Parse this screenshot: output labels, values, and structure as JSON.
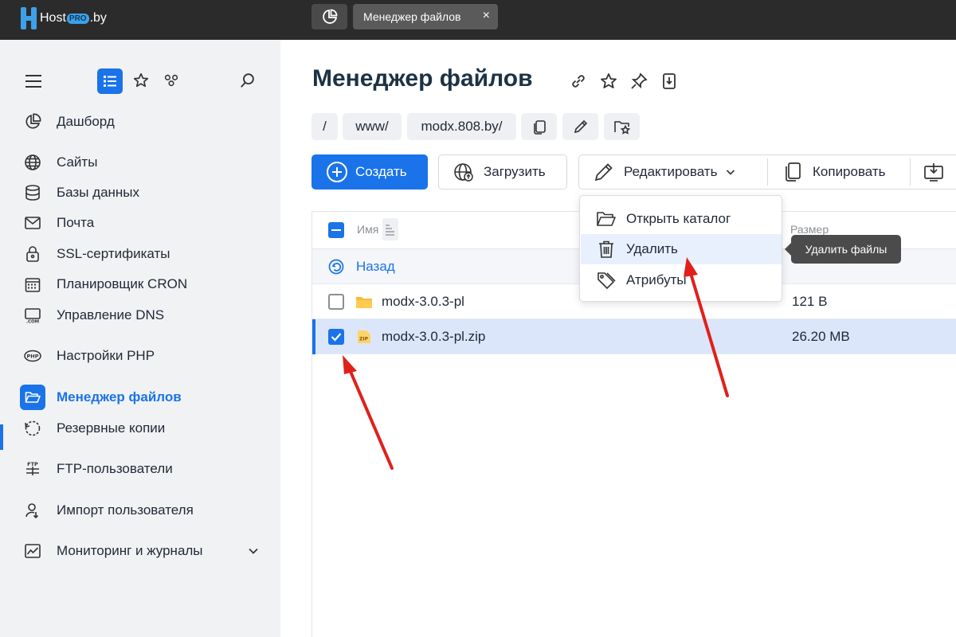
{
  "topbar": {
    "logo": {
      "host": "Host",
      "pro": "PRO",
      "by": ".by"
    },
    "active_tab_label": "Менеджер файлов",
    "tab_close_glyph": "×"
  },
  "sidebar": {
    "items": [
      {
        "label": "Дашборд",
        "icon": "dashboard-icon"
      },
      {
        "label": "Сайты",
        "icon": "globe-icon"
      },
      {
        "label": "Базы данных",
        "icon": "database-icon"
      },
      {
        "label": "Почта",
        "icon": "mail-icon"
      },
      {
        "label": "SSL-сертификаты",
        "icon": "lock-icon"
      },
      {
        "label": "Планировщик CRON",
        "icon": "calendar-icon"
      },
      {
        "label": "Управление DNS",
        "icon": "dns-icon"
      },
      {
        "label": "Настройки PHP",
        "icon": "php-icon"
      },
      {
        "label": "Менеджер файлов",
        "icon": "folder-open-icon",
        "active": true
      },
      {
        "label": "Резервные копии",
        "icon": "backup-icon"
      },
      {
        "label": "FTP-пользователи",
        "icon": "ftp-icon"
      },
      {
        "label": "Импорт пользователя",
        "icon": "user-import-icon"
      },
      {
        "label": "Мониторинг и журналы",
        "icon": "monitoring-icon"
      }
    ]
  },
  "main": {
    "title": "Менеджер файлов",
    "breadcrumbs": [
      "/",
      "www/",
      "modx.808.by/"
    ],
    "toolbar": {
      "create_label": "Создать",
      "upload_label": "Загрузить",
      "edit_label": "Редактировать",
      "copy_label": "Копировать"
    },
    "table": {
      "col_name": "Имя",
      "col_size": "Размер",
      "back_label": "Назад",
      "rows": [
        {
          "name": "modx-3.0.3-pl",
          "size": "121 B",
          "type": "folder",
          "checked": false
        },
        {
          "name": "modx-3.0.3-pl.zip",
          "size": "26.20 MB",
          "type": "zip",
          "checked": true
        }
      ]
    },
    "dropdown": {
      "items": [
        {
          "label": "Открыть каталог",
          "icon": "folder-open-icon"
        },
        {
          "label": "Удалить",
          "icon": "trash-icon"
        },
        {
          "label": "Атрибуты",
          "icon": "tags-icon"
        }
      ]
    },
    "tooltip": "Удалить файлы",
    "zip_badge": "ZIP"
  },
  "colors": {
    "accent": "#1a73e8",
    "topbar": "#2b2b2b",
    "sidebar": "#f1f2f4",
    "annotation_arrow": "#e0201c"
  }
}
